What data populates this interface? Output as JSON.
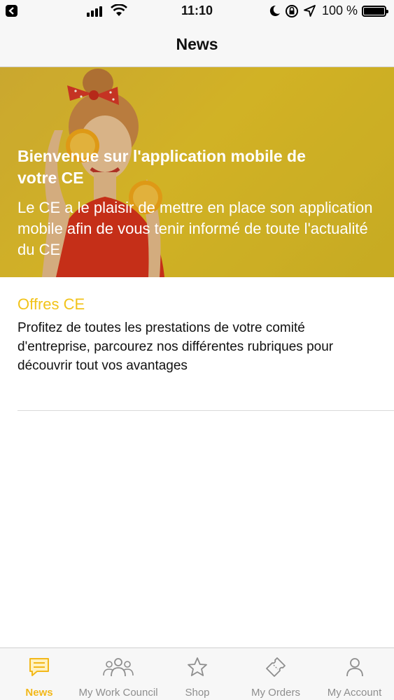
{
  "status_bar": {
    "time": "11:10",
    "battery_percent": "100 %"
  },
  "nav": {
    "title": "News"
  },
  "hero": {
    "title": "Bienvenue sur l'application mobile de votre CE",
    "text": "Le CE a le plaisir de mettre en place son application mobile afin de vous tenir informé de toute l'actualité du CE"
  },
  "offer": {
    "title": "Offres CE",
    "description": "Profitez de toutes les prestations de votre comité d'entreprise, parcourez nos différentes rubriques pour découvrir tout vos avantages"
  },
  "tabs": [
    {
      "label": "News",
      "icon": "news-icon",
      "active": true
    },
    {
      "label": "My Work Council",
      "icon": "group-icon",
      "active": false
    },
    {
      "label": "Shop",
      "icon": "star-icon",
      "active": false
    },
    {
      "label": "My Orders",
      "icon": "ticket-icon",
      "active": false
    },
    {
      "label": "My Account",
      "icon": "person-icon",
      "active": false
    }
  ],
  "colors": {
    "accent": "#f2b81a",
    "hero_background": "#e0c032",
    "inactive_tab": "#8e8e8e"
  }
}
